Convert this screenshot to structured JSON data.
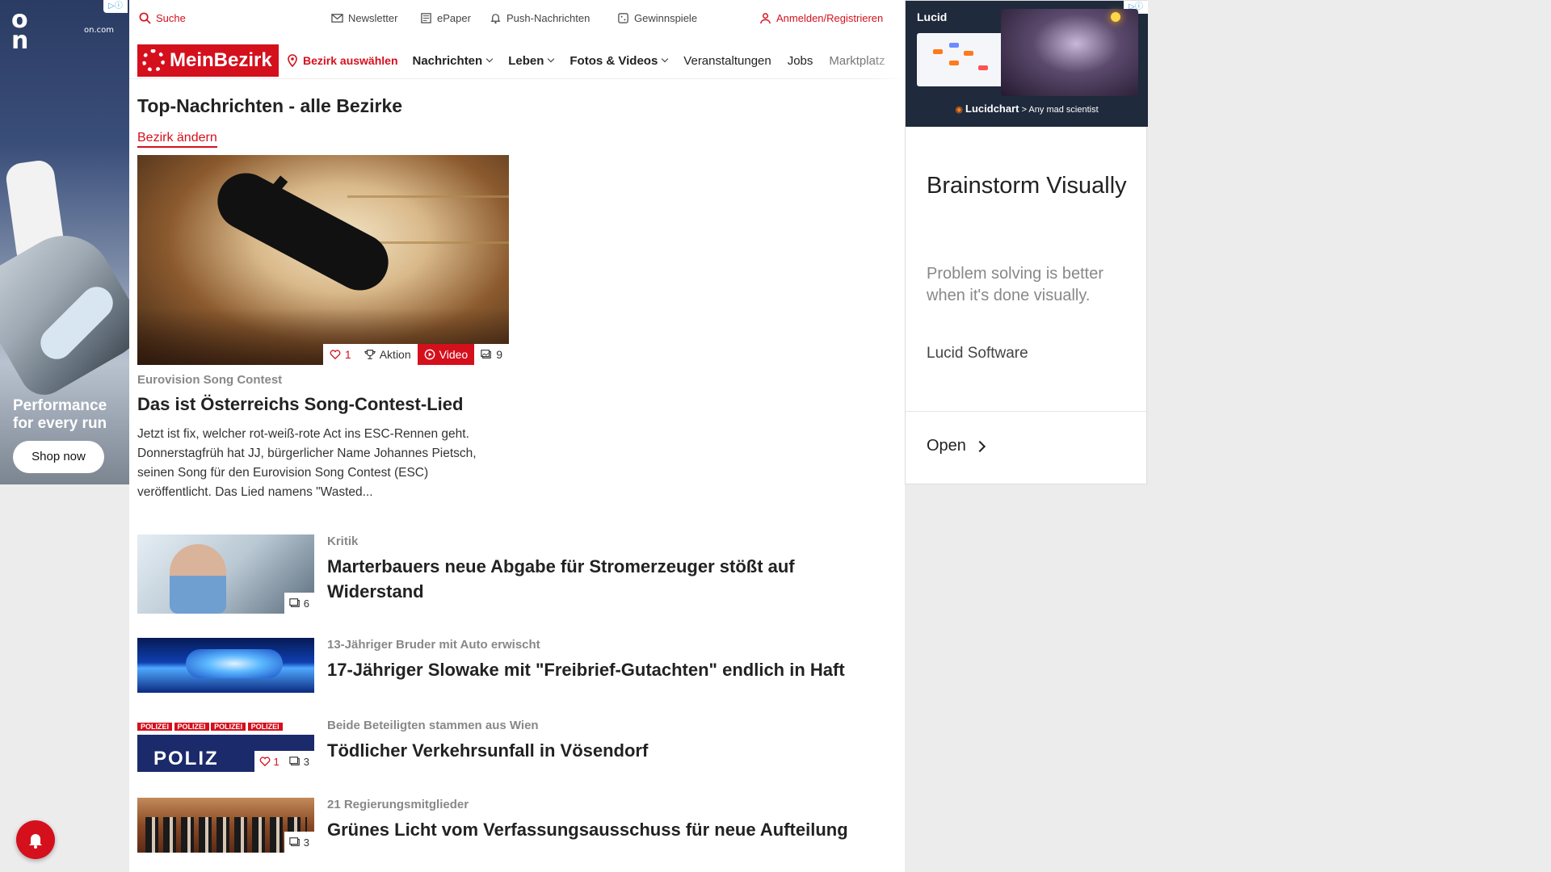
{
  "left_ad": {
    "brand": "On",
    "url": "on.com",
    "ad_marker": "▷ⓘ",
    "tagline_1": "Performance",
    "tagline_2": "for every run",
    "cta": "Shop now"
  },
  "topbar": {
    "search": "Suche",
    "newsletter": "Newsletter",
    "epaper": "ePaper",
    "push": "Push-Nachrichten",
    "gewinnspiele": "Gewinnspiele",
    "login": "Anmelden/Registrieren"
  },
  "nav": {
    "logo": "MeinBezirk",
    "bezirk": "Bezirk auswählen",
    "items": [
      "Nachrichten",
      "Leben",
      "Fotos & Videos",
      "Veranstaltungen",
      "Jobs",
      "Marktplatz"
    ]
  },
  "page": {
    "title": "Top-Nachrichten - alle Bezirke",
    "change_bezirk": "Bezirk ändern"
  },
  "hero": {
    "likes": "1",
    "aktion": "Aktion",
    "video": "Video",
    "photos": "9",
    "kicker": "Eurovision Song Contest",
    "headline": "Das ist Österreichs Song-Contest-Lied",
    "teaser": "Jetzt ist fix, welcher rot-weiß-rote Act ins ESC-Rennen geht. Donnerstagfrüh hat JJ, bürgerlicher Name Johannes Pietsch, seinen Song für den Eurovision Song Contest (ESC) veröffentlicht. Das Lied namens \"Wasted..."
  },
  "articles": [
    {
      "kicker": "Kritik",
      "headline": "Marterbauers neue Abgabe für Stromerzeuger stößt auf Widerstand",
      "photos": "6"
    },
    {
      "kicker": "13-Jähriger Bruder mit Auto erwischt",
      "headline": "17-Jähriger Slowake mit \"Freibrief-Gutachten\" endlich in Haft"
    },
    {
      "kicker": "Beide Beteiligten stammen aus Wien",
      "headline": "Tödlicher Verkehrsunfall in Vösendorf",
      "likes": "1",
      "photos": "3",
      "tape_text": "POLIZEI",
      "sign_text": "POLIZ"
    },
    {
      "kicker": "21 Regierungsmitglieder",
      "headline": "Grünes Licht vom Verfassungsausschuss für neue Aufteilung",
      "photos": "3"
    }
  ],
  "right_ad": {
    "brand": "Lucid",
    "ad_marker": "▷ⓘ",
    "caption_brand": "Lucidchart",
    "caption_rest": "> Any mad scientist",
    "title": "Brainstorm Visually",
    "description": "Problem solving is better when it's done visually.",
    "company": "Lucid Software",
    "cta": "Open"
  },
  "colors": {
    "brand_red": "#d5101d",
    "ad_navy": "#1f2a3c"
  }
}
